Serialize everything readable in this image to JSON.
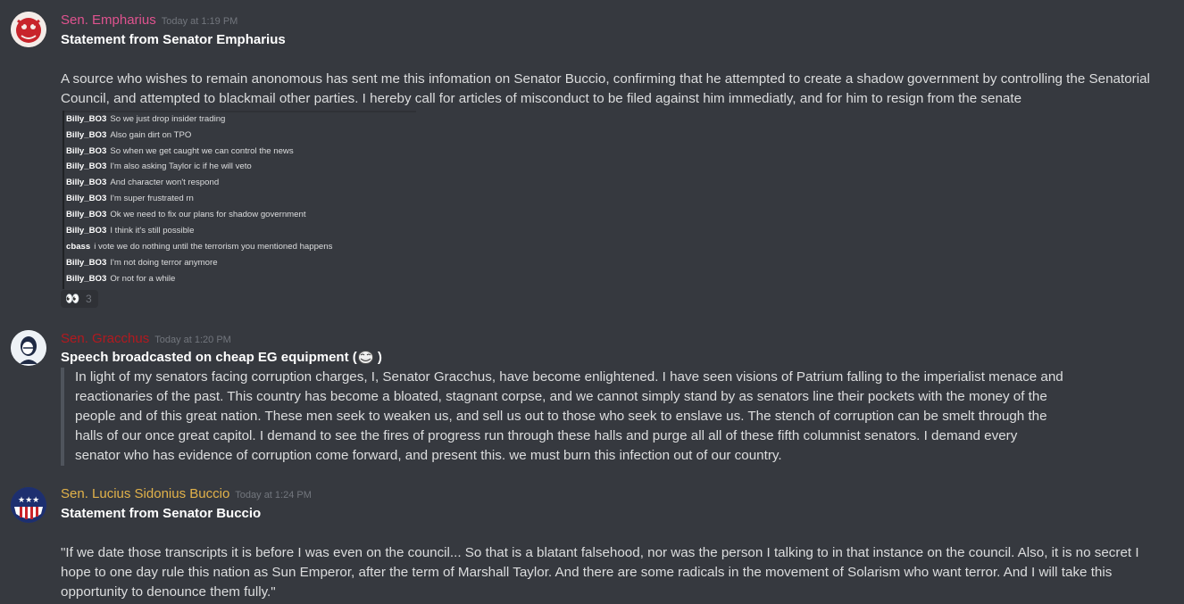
{
  "messages": [
    {
      "author": "Sen. Empharius",
      "author_color": "#e0538f",
      "timestamp": "Today at 1:19 PM",
      "title": "Statement from Senator Empharius",
      "body": "A source who wishes to remain anonomous has sent me this infomation on Senator Buccio, confirming that he attempted to create a shadow government by controlling the Senatorial Council, and attempted to blackmail other parties. I hereby call for articles of misconduct to be filed against him immediatly, and for him to resign from the senate",
      "attachment_lines": [
        {
          "user": "Billy_BO3",
          "text": "So we just drop insider trading"
        },
        {
          "user": "Billy_BO3",
          "text": "Also gain dirt on TPO"
        },
        {
          "user": "Billy_BO3",
          "text": "So when we get caught we can control the news"
        },
        {
          "user": "Billy_BO3",
          "text": "I'm also asking Taylor ic if he will veto"
        },
        {
          "user": "Billy_BO3",
          "text": "And character won't respond"
        },
        {
          "user": "Billy_BO3",
          "text": "I'm super frustrated rn"
        },
        {
          "user": "Billy_BO3",
          "text": "Ok we need to fix our plans for shadow government"
        },
        {
          "user": "Billy_BO3",
          "text": "I think it's still possible"
        },
        {
          "user": "cbass",
          "text": "i vote we do nothing until the terrorism you mentioned happens"
        },
        {
          "user": "Billy_BO3",
          "text": "I'm not doing terror anymore"
        },
        {
          "user": "Billy_BO3",
          "text": "Or not for a while"
        }
      ],
      "reaction": {
        "emoji": "eyes-emoji",
        "glyph": "👀",
        "count": "3"
      }
    },
    {
      "author": "Sen. Gracchus",
      "author_color": "#b3191f",
      "timestamp": "Today at 1:20 PM",
      "title": "Speech broadcasted on cheap EG equipment (",
      "title_end": " )",
      "title_emoji": "trollface-emoji",
      "quote": "In light of my senators facing corruption charges, I, Senator Gracchus, have become enlightened. I have seen visions of Patrium falling to the imperialist menace and reactionaries of the past. This country has become a bloated, stagnant corpse, and we cannot simply stand by as senators line their pockets with the money of the people and of this great nation. These men seek to weaken us, and sell us out to those who seek to enslave us. The stench of corruption can be smelt through the halls of our once great capitol. I demand to see the fires of progress run through these halls and purge all all of these fifth columnist senators. I demand every senator who has evidence of corruption come forward, and present this. we must burn this infection out of our country."
    },
    {
      "author": "Sen. Lucius Sidonius Buccio",
      "author_color": "#e2b24a",
      "timestamp": "Today at 1:24 PM",
      "title": "Statement from Senator Buccio",
      "body": "\"If we date those transcripts it is before I was even on the council... So that is a blatant falsehood, nor was the person I talking to in that instance on the council. Also, it is no secret I hope to one day rule this nation as Sun Emperor, after the term of Marshall Taylor. And there are some radicals in the movement of Solarism who want terror. And I will take this opportunity to denounce them fully.\""
    }
  ]
}
